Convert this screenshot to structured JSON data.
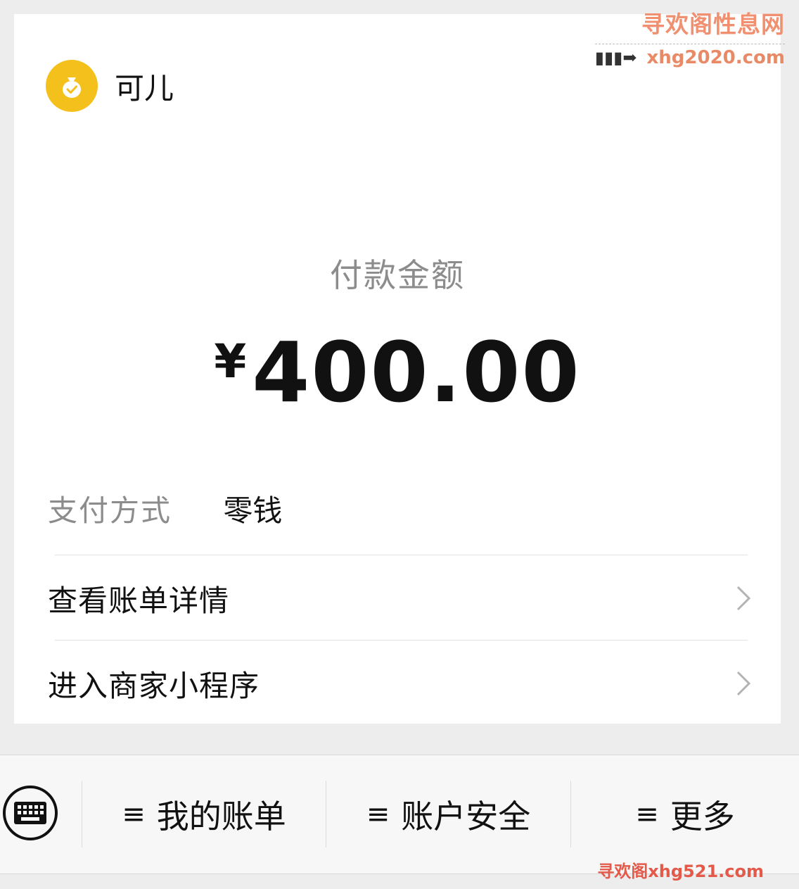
{
  "merchant": {
    "name": "可儿",
    "logo_icon": "money-bag-icon"
  },
  "payment": {
    "amount_label": "付款金额",
    "currency": "¥",
    "amount": "400.00",
    "method_label": "支付方式",
    "method_value": "零钱"
  },
  "links": [
    {
      "label": "查看账单详情"
    },
    {
      "label": "进入商家小程序"
    }
  ],
  "bottom_menu": {
    "keyboard_icon": "keyboard-icon",
    "items": [
      {
        "icon": "≡",
        "label": "我的账单"
      },
      {
        "icon": "≡",
        "label": "账户安全"
      },
      {
        "icon": "≡",
        "label": "更多"
      }
    ]
  },
  "watermarks": {
    "top_title": "寻欢阁性息网",
    "top_arrow": "▮▮▮➡",
    "top_url": "xhg2020.com",
    "bottom": "寻欢阁xhg521.com"
  },
  "colors": {
    "logo": "#f4c01c",
    "background": "#ededed",
    "card": "#ffffff"
  }
}
